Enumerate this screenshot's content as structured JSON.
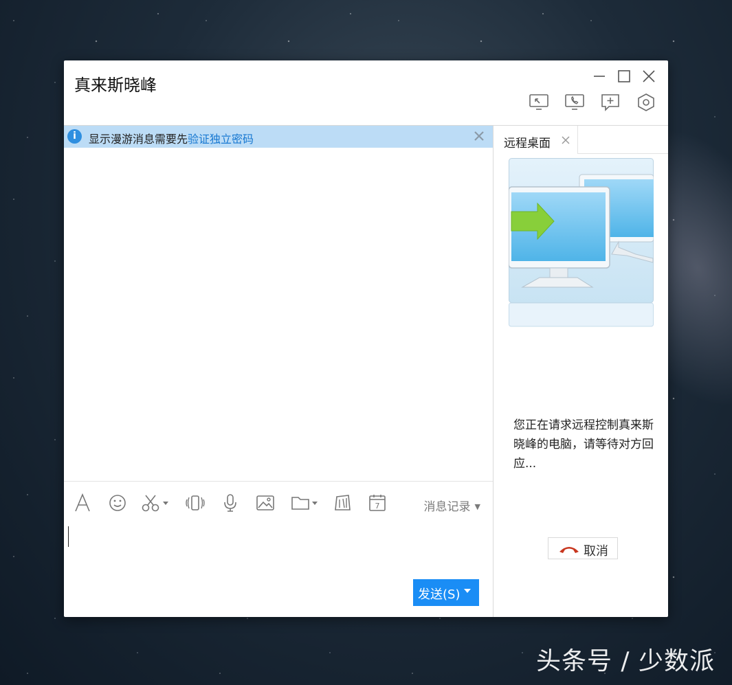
{
  "window": {
    "title": "真来斯晓峰"
  },
  "notice": {
    "text": "显示漫游消息需要先",
    "link": "验证独立密码",
    "info_icon": "i"
  },
  "toolbar": {
    "history_label": "消息记录",
    "icons": [
      "font-icon",
      "emoji-icon",
      "screenshot-icon",
      "shake-icon",
      "voice-icon",
      "image-icon",
      "folder-icon",
      "gift-icon",
      "calendar-icon"
    ]
  },
  "input": {
    "send_label": "发送(S)"
  },
  "remote": {
    "tab_label": "远程桌面",
    "status_text": "您正在请求远程控制真来斯晓峰的电脑，请等待对方回应...",
    "cancel_label": "取消"
  },
  "watermark": "头条号 / 少数派",
  "colors": {
    "accent": "#1a8df5",
    "notice_bg": "#bcdcf6",
    "link": "#1778d1",
    "hangup": "#c8361e"
  }
}
